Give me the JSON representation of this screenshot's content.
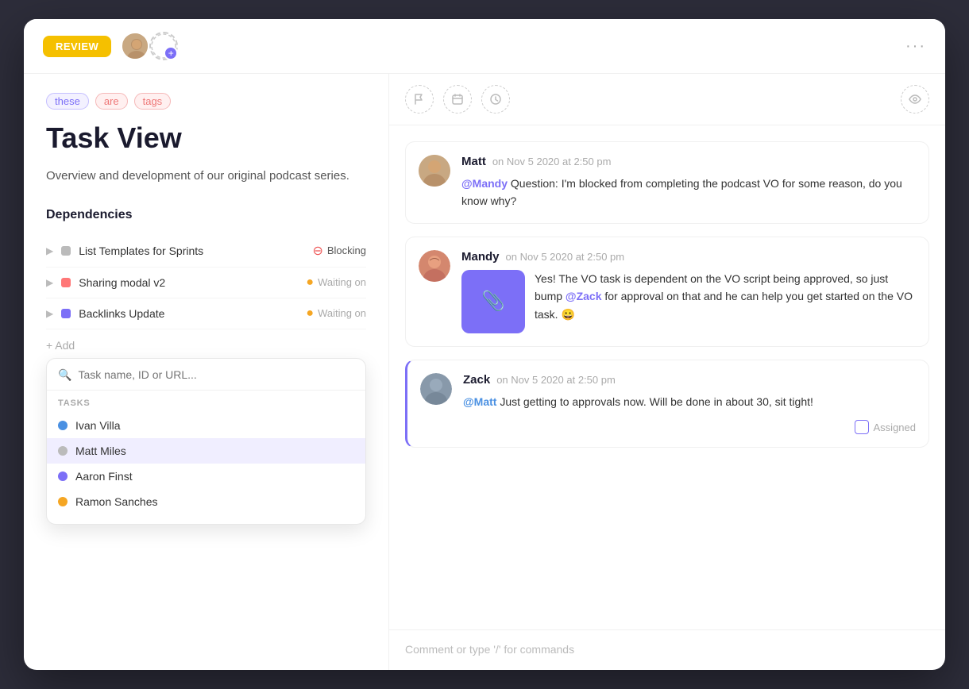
{
  "header": {
    "review_label": "REVIEW",
    "more_dots": "···"
  },
  "left": {
    "tags": [
      "these",
      "are",
      "tags"
    ],
    "title": "Task View",
    "description": "Overview and development of our original podcast series.",
    "dependencies_label": "Dependencies",
    "add_label": "+ Add",
    "dependencies": [
      {
        "name": "List Templates for Sprints",
        "dot_color": "gray",
        "status": "Blocking",
        "status_type": "blocking"
      },
      {
        "name": "Sharing modal v2",
        "dot_color": "pink",
        "status": "Waiting on",
        "status_type": "waiting"
      },
      {
        "name": "Backlinks Update",
        "dot_color": "purple",
        "status": "Waiting on",
        "status_type": "waiting"
      }
    ],
    "search": {
      "placeholder": "Task name, ID or URL...",
      "tasks_label": "TASKS",
      "options": [
        {
          "name": "Ivan Villa",
          "dot": "blue"
        },
        {
          "name": "Matt Miles",
          "dot": "gray",
          "selected": true
        },
        {
          "name": "Aaron Finst",
          "dot": "purple"
        },
        {
          "name": "Ramon Sanches",
          "dot": "yellow"
        }
      ]
    }
  },
  "right": {
    "toolbar_icons": [
      "flag",
      "calendar",
      "clock",
      "eye"
    ],
    "comments": [
      {
        "id": "matt",
        "author": "Matt",
        "time": "on Nov 5 2020 at 2:50 pm",
        "text": "@Mandy Question: I'm blocked from completing the podcast VO for some reason, do you know why?",
        "mention": "@Mandy",
        "has_image": false
      },
      {
        "id": "mandy",
        "author": "Mandy",
        "time": "on Nov 5 2020 at 2:50 pm",
        "text": "Yes! The VO task is dependent on the VO script being approved, so just bump @Zack for approval on that and he can help you get started on the VO task. 😀",
        "mention": "@Zack",
        "has_image": true
      },
      {
        "id": "zack",
        "author": "Zack",
        "time": "on Nov 5 2020 at 2:50 pm",
        "text": "@Matt Just getting to approvals now. Will be done in about 30, sit tight!",
        "mention": "@Matt",
        "has_assigned": true,
        "assigned_label": "Assigned"
      }
    ],
    "comment_placeholder": "Comment or type '/' for commands"
  }
}
